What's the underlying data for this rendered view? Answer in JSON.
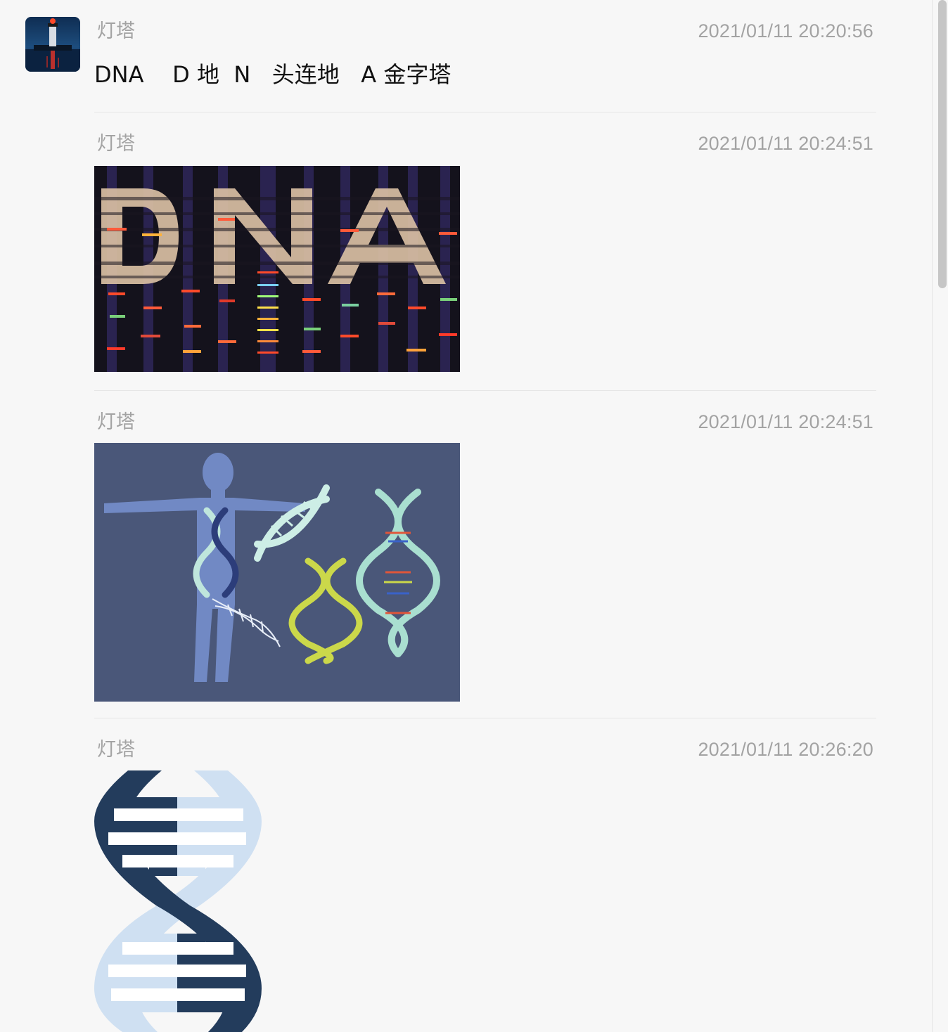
{
  "conversation": {
    "avatar_icon": "lighthouse-avatar",
    "messages": [
      {
        "sender": "灯塔",
        "time": "2021/01/11 20:20:56",
        "type": "text",
        "text": "DNA    D 地  N   头连地   A 金字塔"
      },
      {
        "sender": "灯塔",
        "time": "2021/01/11 20:24:51",
        "type": "image",
        "image_icon": "dna-gel-photo"
      },
      {
        "sender": "灯塔",
        "time": "2021/01/11 20:24:51",
        "type": "image",
        "image_icon": "human-dna-illustration"
      },
      {
        "sender": "灯塔",
        "time": "2021/01/11 20:26:20",
        "type": "image",
        "image_icon": "dna-helix-graphic"
      }
    ]
  },
  "colors": {
    "background": "#f7f7f7",
    "meta_text": "#a3a3a3",
    "body_text": "#111111",
    "divider": "#e6e6e6"
  }
}
